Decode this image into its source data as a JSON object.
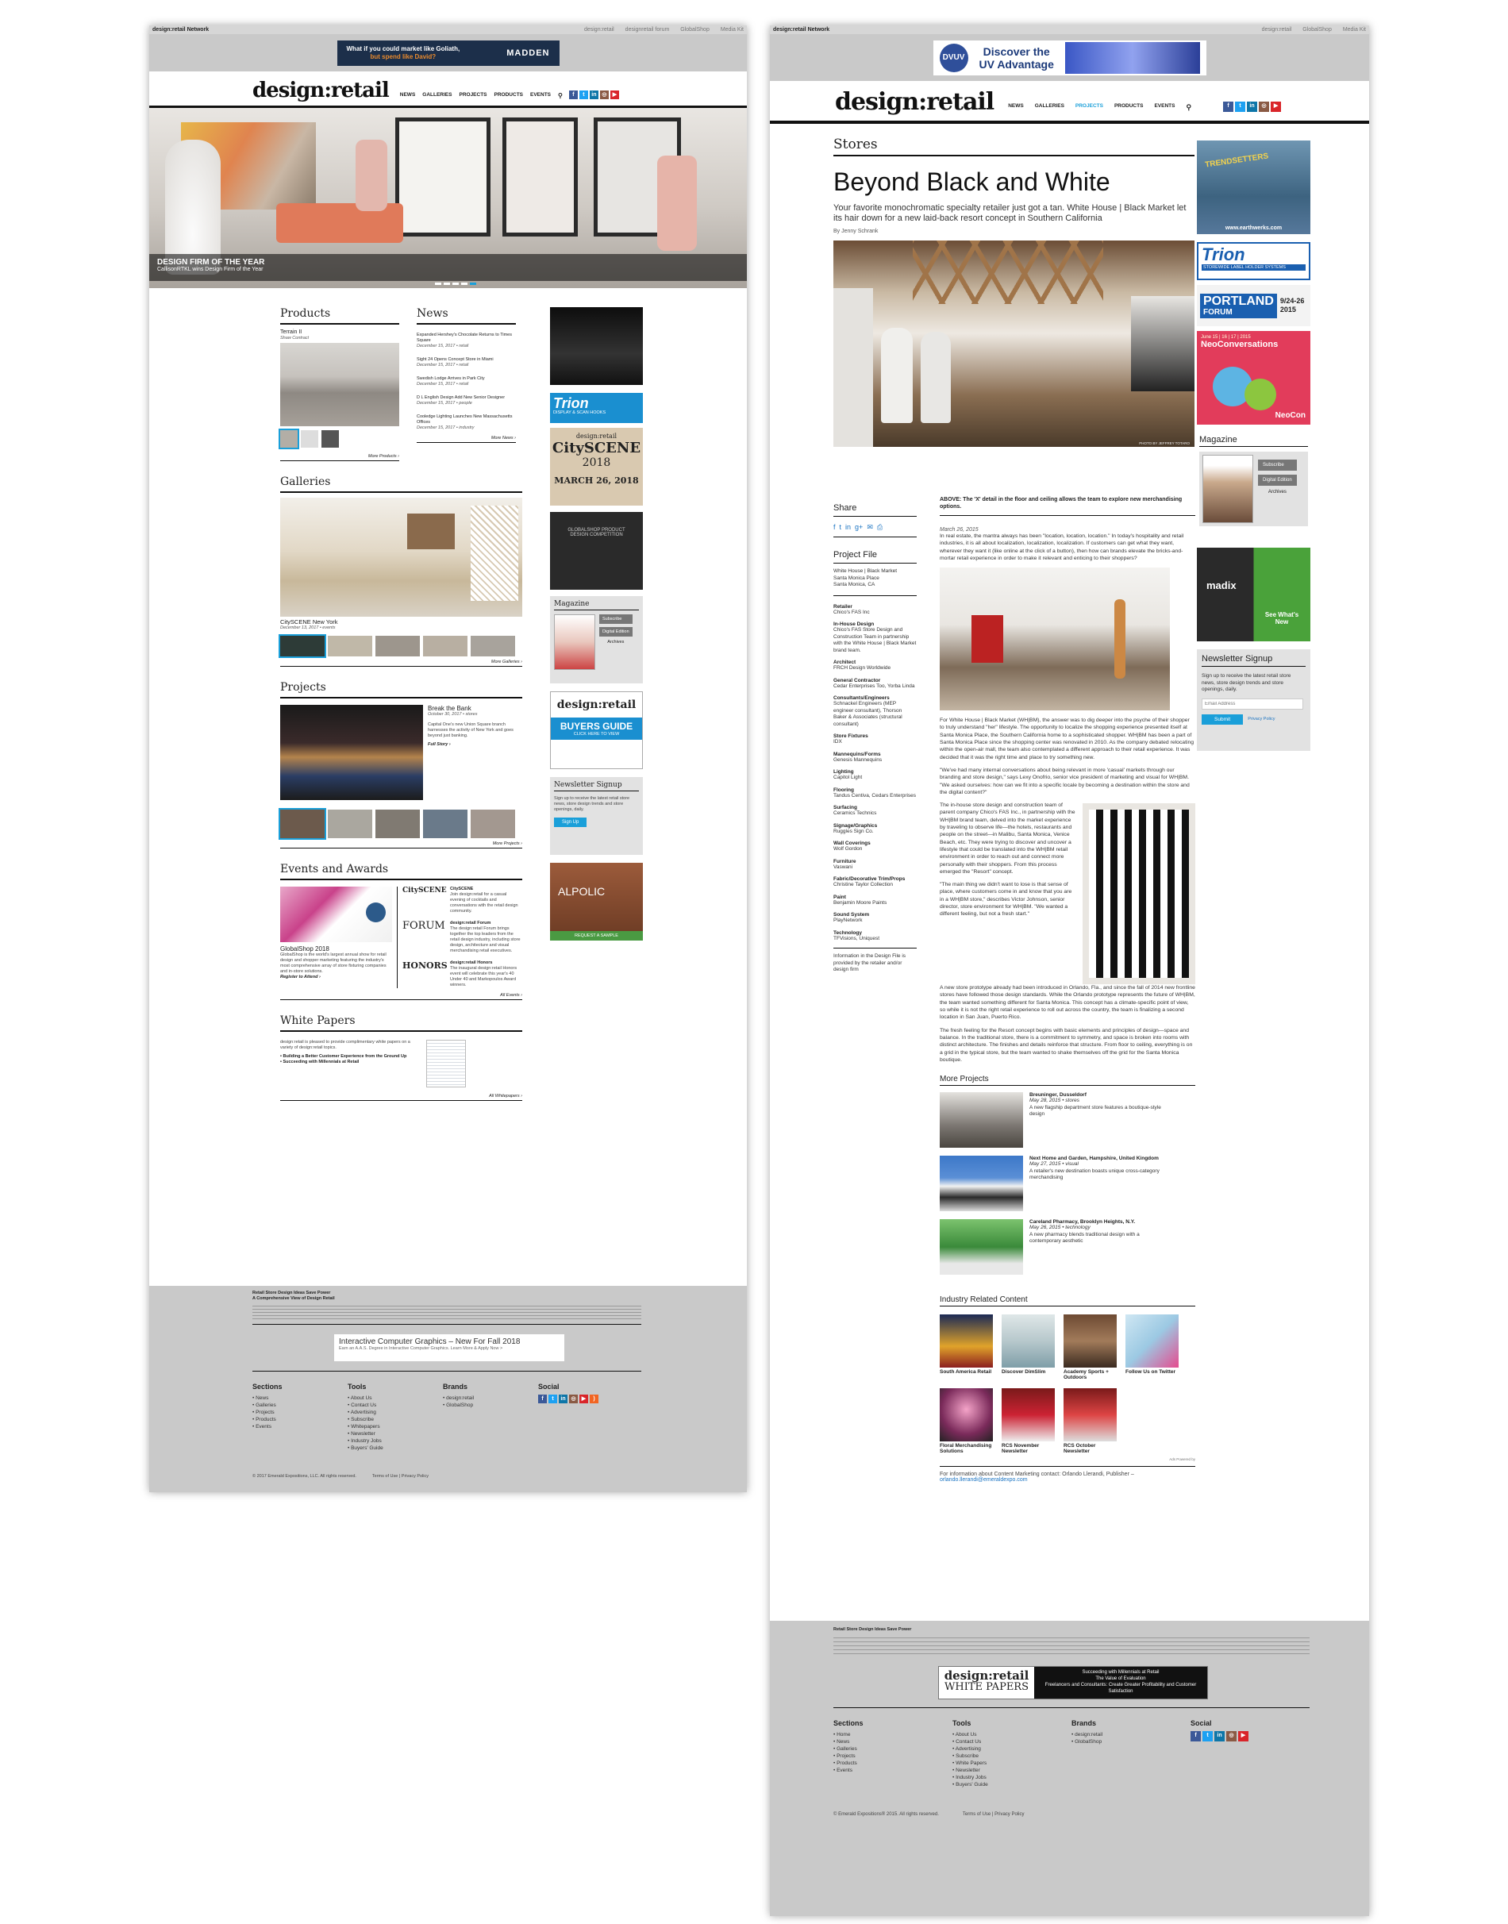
{
  "left": {
    "network": "design:retail Network",
    "network_links": [
      "design:retail",
      "designretail forum",
      "GlobalShop",
      "Media Kit"
    ],
    "top_ad": {
      "line1": "What if you could market like Goliath,",
      "line2": "but spend like David?",
      "brand": "MADDEN"
    },
    "logo": "design:retail",
    "nav": [
      "NEWS",
      "GALLERIES",
      "PROJECTS",
      "PRODUCTS",
      "EVENTS"
    ],
    "hero": {
      "title": "DESIGN FIRM OF THE YEAR",
      "subtitle": "CallisonRTKL wins Design Firm of the Year"
    },
    "products": {
      "heading": "Products",
      "item_title": "Terrain II",
      "item_sub": "Shaw Contract",
      "more": "More Products ›"
    },
    "news": {
      "heading": "News",
      "items": [
        {
          "title": "Expanded Hershey's Chocolate Returns to Times Square",
          "meta": "December 15, 2017 • retail"
        },
        {
          "title": "Sight 24 Opens Concept Store in Miami",
          "meta": "December 15, 2017 • retail"
        },
        {
          "title": "Swedish Lodge Arrives in Park City",
          "meta": "December 15, 2017 • retail"
        },
        {
          "title": "D L English Design Add New Senior Designer",
          "meta": "December 15, 2017 • people"
        },
        {
          "title": "Cooledge Lighting Launches New Massachusetts Offices",
          "meta": "December 15, 2017 • industry"
        }
      ],
      "more": "More News ›"
    },
    "galleries": {
      "heading": "Galleries",
      "item_title": "CitySCENE New York",
      "item_meta": "December 13, 2017 • events",
      "more": "More Galleries ›"
    },
    "projects": {
      "heading": "Projects",
      "item_title": "Break the Bank",
      "item_meta": "October 30, 2017 • stores",
      "item_desc": "Capital One's new Union Square branch harnesses the activity of New York and goes beyond just banking.",
      "item_link": "Full Story ›",
      "more": "More Projects ›"
    },
    "events": {
      "heading": "Events and Awards",
      "gs_title": "GlobalShop 2018",
      "gs_desc": "GlobalShop is the world's largest annual show for retail design and shopper marketing featuring the industry's most comprehensive array of store fixturing companies and in-store solutions.",
      "gs_link": "Register to Attend ›",
      "cs_title": "CitySCENE",
      "cs_desc": "Join design:retail for a casual evening of cocktails and conversations with the retail design community.",
      "forum_title": "design:retail Forum",
      "forum_desc": "The design:retail Forum brings together the top leaders from the retail design industry, including store design, architecture and visual merchandising retail executives.",
      "honors_title": "design:retail Honors",
      "honors_desc": "The inaugural design:retail Honors event will celebrate this year's 40 Under 40 and Markopoulos Award winners.",
      "more": "All Events ›"
    },
    "whitepapers": {
      "heading": "White Papers",
      "intro": "design:retail is pleased to provide complimentary white papers on a variety of design:retail topics.",
      "items": [
        "Building a Better Customer Experience from the Ground Up",
        "Succeeding with Millennials at Retail"
      ],
      "more": "All Whitepapers ›"
    },
    "side": {
      "trion": "Trion",
      "trion_sub": "DISPLAY & SCAN HOOKS",
      "cityscene_brand": "design:retail",
      "cityscene": "CitySCENE",
      "cityscene_year": "2018",
      "cityscene_date": "MARCH 26, 2018",
      "gs_comp": "GLOBALSHOP PRODUCT DESIGN COMPETITION",
      "magazine": "Magazine",
      "subscribe": "Subscribe",
      "digital": "Digital Edition",
      "archives": "Archives",
      "buyers_brand": "design:retail",
      "buyers": "BUYERS GUIDE",
      "buyers_cta": "CLICK HERE TO VIEW",
      "newsletter": "Newsletter Signup",
      "newsletter_desc": "Sign up to receive the latest retail store news, store design trends and store openings, daily.",
      "signup": "Sign Up",
      "alpolic": "ALPOLIC",
      "alpolic_cta": "REQUEST A SAMPLE"
    },
    "footer": {
      "tag1": "Retail Store Design Ideas Save Power",
      "tag2": "A Comprehensive View of Design Retail",
      "ad": "Interactive Computer Graphics – New For Fall 2018",
      "ad_sub": "Earn an A.A.S. Degree in Interactive Computer Graphics. Learn More & Apply Now >",
      "sections": {
        "h": "Sections",
        "items": [
          "News",
          "Galleries",
          "Projects",
          "Products",
          "Events"
        ]
      },
      "tools": {
        "h": "Tools",
        "items": [
          "About Us",
          "Contact Us",
          "Advertising",
          "Subscribe",
          "Whitepapers",
          "Newsletter",
          "Industry Jobs",
          "Buyers' Guide"
        ]
      },
      "brands": {
        "h": "Brands",
        "items": [
          "design:retail",
          "GlobalShop"
        ]
      },
      "social": {
        "h": "Social"
      },
      "copy": "© 2017 Emerald Expositions, LLC. All rights reserved.",
      "terms": "Terms of Use | Privacy Policy"
    }
  },
  "right": {
    "network": "design:retail Network",
    "network_links": [
      "design:retail",
      "GlobalShop",
      "Media Kit"
    ],
    "top_ad": {
      "brand": "DVUV",
      "line1": "Discover the",
      "line2": "UV Advantage"
    },
    "logo": "design:retail",
    "nav": [
      "NEWS",
      "GALLERIES",
      "PROJECTS",
      "PRODUCTS",
      "EVENTS"
    ],
    "kicker": "Stores",
    "title": "Beyond Black and White",
    "dek": "Your favorite monochromatic specialty retailer just got a tan. White House | Black Market let its hair down for a new laid-back resort concept in Southern California",
    "byline": "By Jenny Schrank",
    "photo_credit": "PHOTO BY JEFFREY TOTARO",
    "caption": "ABOVE: The 'X' detail in the floor and ceiling allows the team to explore new merchandising options.",
    "share": "Share",
    "project_file": "Project File",
    "location": [
      "White House | Black Market",
      "Santa Monica Place",
      "Santa Monica, CA"
    ],
    "credits": [
      {
        "l": "Retailer",
        "v": "Chico's FAS Inc"
      },
      {
        "l": "In-House Design",
        "v": "Chico's FAS Store Design and Construction Team in partnership with the White House | Black Market brand team."
      },
      {
        "l": "Architect",
        "v": "FRCH Design Worldwide"
      },
      {
        "l": "General Contractor",
        "v": "Cedar Enterprises Too, Yorba Linda"
      },
      {
        "l": "Consultants/Engineers",
        "v": "Schnackel Engineers (MEP engineer consultant), Thorson Baker & Associates (structural consultant)"
      },
      {
        "l": "Store Fixtures",
        "v": "IDX"
      },
      {
        "l": "Mannequins/Forms",
        "v": "Genesis Mannequins"
      },
      {
        "l": "Lighting",
        "v": "Capitol Light"
      },
      {
        "l": "Flooring",
        "v": "Tandus Centiva, Cedars Enterprises"
      },
      {
        "l": "Surfacing",
        "v": "Ceramics Technics"
      },
      {
        "l": "Signage/Graphics",
        "v": "Ruggles Sign Co."
      },
      {
        "l": "Wall Coverings",
        "v": "Wolf Gordon"
      },
      {
        "l": "Furniture",
        "v": "Vaswani"
      },
      {
        "l": "Fabric/Decorative Trim/Props",
        "v": "Christine Taylor Collection"
      },
      {
        "l": "Paint",
        "v": "Benjamin Moore Paints"
      },
      {
        "l": "Sound System",
        "v": "PlayNetwork"
      },
      {
        "l": "Technology",
        "v": "TFVisions, Uniquest"
      }
    ],
    "credits_note": "Information in the Design File is provided by the retailer and/or design firm",
    "date": "March 26, 2015",
    "paras": [
      "In real estate, the mantra always has been \"location, location, location.\" In today's hospitality and retail industries, it is all about localization, localization, localization. If customers can get what they want, wherever they want it (like online at the click of a button), then how can brands elevate the bricks-and-mortar retail experience in order to make it relevant and enticing to their shoppers?",
      "For White House | Black Market (WH|BM), the answer was to dig deeper into the psyche of their shopper to truly understand \"her\" lifestyle. The opportunity to localize the shopping experience presented itself at Santa Monica Place, the Southern California home to a sophisticated shopper. WH|BM has been a part of Santa Monica Place since the shopping center was renovated in 2010. As the company debated relocating within the open-air mall, the team also contemplated a different approach to their retail experience. It was decided that it was the right time and place to try something new.",
      "\"We've had many internal conversations about being relevant in more 'casual' markets through our branding and store design,\" says Lexy Onofrio, senior vice president of marketing and visual for WH|BM. \"We asked ourselves: how can we fit into a specific locale by becoming a destination within the store and the digital content?\"",
      "The in-house store design and construction team of parent company Chico's FAS Inc., in partnership with the WH|BM brand team, delved into the market experience by traveling to observe life—the hotels, restaurants and people on the street—in Malibu, Santa Monica, Venice Beach, etc. They were trying to discover and uncover a lifestyle that could be translated into the WH|BM retail environment in order to reach out and connect more personally with their shoppers. From this process emerged the \"Resort\" concept.",
      "\"The main thing we didn't want to lose is that sense of place, where customers come in and know that you are in a WH|BM store,\" describes Victor Johnson, senior director, store environment for WH|BM. \"We wanted a different feeling, but not a fresh start.\"",
      "A new store prototype already had been introduced in Orlando, Fla., and since the fall of 2014 new frontline stores have followed those design standards. While the Orlando prototype represents the future of WH|BM, the team wanted something different for Santa Monica. This concept has a climate-specific point of view, so while it is not the right retail experience to roll out across the country, the team is finalizing a second location in San Juan, Puerto Rico.",
      "The fresh feeling for the Resort concept begins with basic elements and principles of design—space and balance. In the traditional store, there is a commitment to symmetry, and space is broken into rooms with distinct architecture. The finishes and details reinforce that structure. From floor to ceiling, everything is on a grid in the typical store, but the team wanted to shake themselves off the grid for the Santa Monica boutique."
    ],
    "more_projects": {
      "heading": "More Projects",
      "items": [
        {
          "title": "Breuninger, Dusseldorf",
          "meta": "May 28, 2015 • stores",
          "desc": "A new flagship department store features a boutique-style design"
        },
        {
          "title": "Next Home and Garden, Hampshire, United Kingdom",
          "meta": "May 27, 2015 • visual",
          "desc": "A retailer's new destination boasts unique cross-category merchandising"
        },
        {
          "title": "Careland Pharmacy, Brooklyn Heights, N.Y.",
          "meta": "May 26, 2015 • technology",
          "desc": "A new pharmacy blends traditional design with a contemporary aesthetic"
        }
      ]
    },
    "industry": {
      "heading": "Industry Related Content",
      "items": [
        "South America Retail",
        "Discover DimSlim",
        "Academy Sports + Outdoors",
        "Follow Us on Twitter",
        "Floral Merchandising Solutions",
        "RCS November Newsletter",
        "RCS October Newsletter"
      ],
      "ads_by": "Ads Powered by"
    },
    "contact": "For information about Content Marketing contact: Orlando Llerandi, Publisher –",
    "contact_email": "orlando.llerandi@emeraldexpo.com",
    "side": {
      "earthwerks": "www.earthwerks.com",
      "trendsetters": "TRENDSETTERS",
      "trion": "Trion",
      "trion_sub": "STOREWIDE LABEL HOLDER SYSTEMS",
      "portland": "PORTLAND",
      "forum": "FORUM",
      "portland_date": "9/24-26",
      "portland_year": "2015",
      "neo_date": "June 15 | 16 | 17 | 2015",
      "neo": "NeoConversations",
      "neo_brand": "NeoCon",
      "magazine": "Magazine",
      "subscribe": "Subscribe",
      "digital": "Digital Edition",
      "archives": "Archives",
      "madix": "madix",
      "new": "See What's New",
      "newsletter": "Newsletter Signup",
      "newsletter_desc": "Sign up to receive the latest retail store news, store design trends and store openings, daily.",
      "email_placeholder": "Email Address",
      "submit": "Submit",
      "privacy": "Privacy Policy"
    },
    "footer": {
      "tag1": "Retail Store Design Ideas Save Power",
      "wp_brand": "design:retail",
      "wp_label": "WHITE PAPERS",
      "wp_t1": "Succeeding with Millennials at Retail",
      "wp_t2": "The Value of Evaluation",
      "wp_t3": "Freelancers and Consultants: Create Greater Profitability and Customer Satisfaction",
      "sections": {
        "h": "Sections",
        "items": [
          "Home",
          "News",
          "Galleries",
          "Projects",
          "Products",
          "Events"
        ]
      },
      "tools": {
        "h": "Tools",
        "items": [
          "About Us",
          "Contact Us",
          "Advertising",
          "Subscribe",
          "White Papers",
          "Newsletter",
          "Industry Jobs",
          "Buyers' Guide"
        ]
      },
      "brands": {
        "h": "Brands",
        "items": [
          "design:retail",
          "GlobalShop"
        ]
      },
      "social": {
        "h": "Social"
      },
      "copy": "© Emerald Expositions® 2015. All rights reserved.",
      "terms": "Terms of Use | Privacy Policy"
    }
  },
  "social_colors": {
    "facebook": "#3b5998",
    "twitter": "#1da1f2",
    "linkedin": "#0e76a8",
    "instagram": "#8a5a44",
    "youtube": "#d9252a",
    "rss": "#f26522"
  }
}
